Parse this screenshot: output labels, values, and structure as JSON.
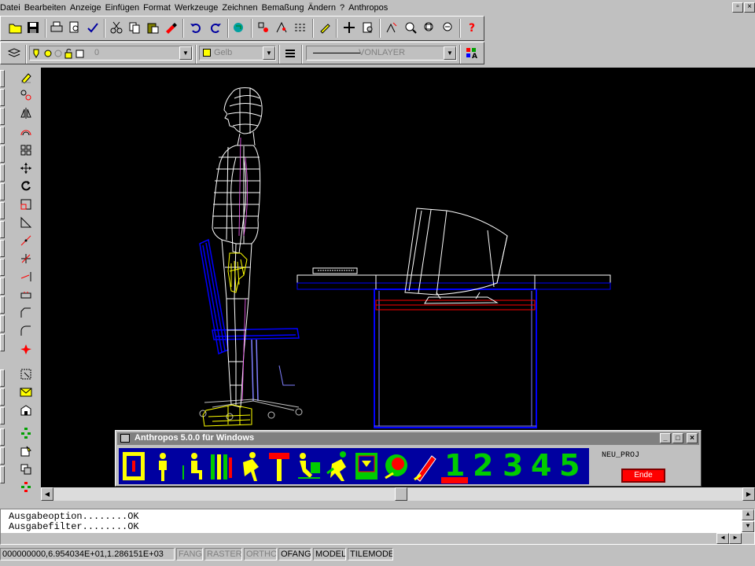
{
  "menu": {
    "items": [
      "Datei",
      "Bearbeiten",
      "Anzeige",
      "Einfügen",
      "Format",
      "Werkzeuge",
      "Zeichnen",
      "Bemaßung",
      "Ändern",
      "?",
      "Anthropos"
    ]
  },
  "window_controls": {
    "restore": "▫",
    "close": "×"
  },
  "layer_toolbar": {
    "layer_value": "0",
    "color_value": "Gelb",
    "linetype_value": "VONLAYER"
  },
  "anthropos": {
    "title": "Anthropos 5.0.0 für Windows",
    "project": "NEU_PROJ",
    "end_button": "Ende",
    "numbers": [
      "1",
      "2",
      "3",
      "4",
      "5"
    ]
  },
  "command": {
    "lines": [
      "Ausgabeoption........OK",
      "Ausgabefilter........OK"
    ]
  },
  "status": {
    "coords": "000000000,6.954034E+01,1.286151E+03",
    "toggles": [
      "FANG",
      "RASTER",
      "ORTHO",
      "OFANG",
      "MODEL",
      "TILEMODE"
    ]
  },
  "colors": {
    "drawing_bg": "#000000",
    "desk": "#0000ff",
    "figure": "#ffffff",
    "hand": "#ffff00",
    "palette_bg": "#0000a0",
    "end_button": "#ff0000",
    "numbers": "#00cc00"
  }
}
